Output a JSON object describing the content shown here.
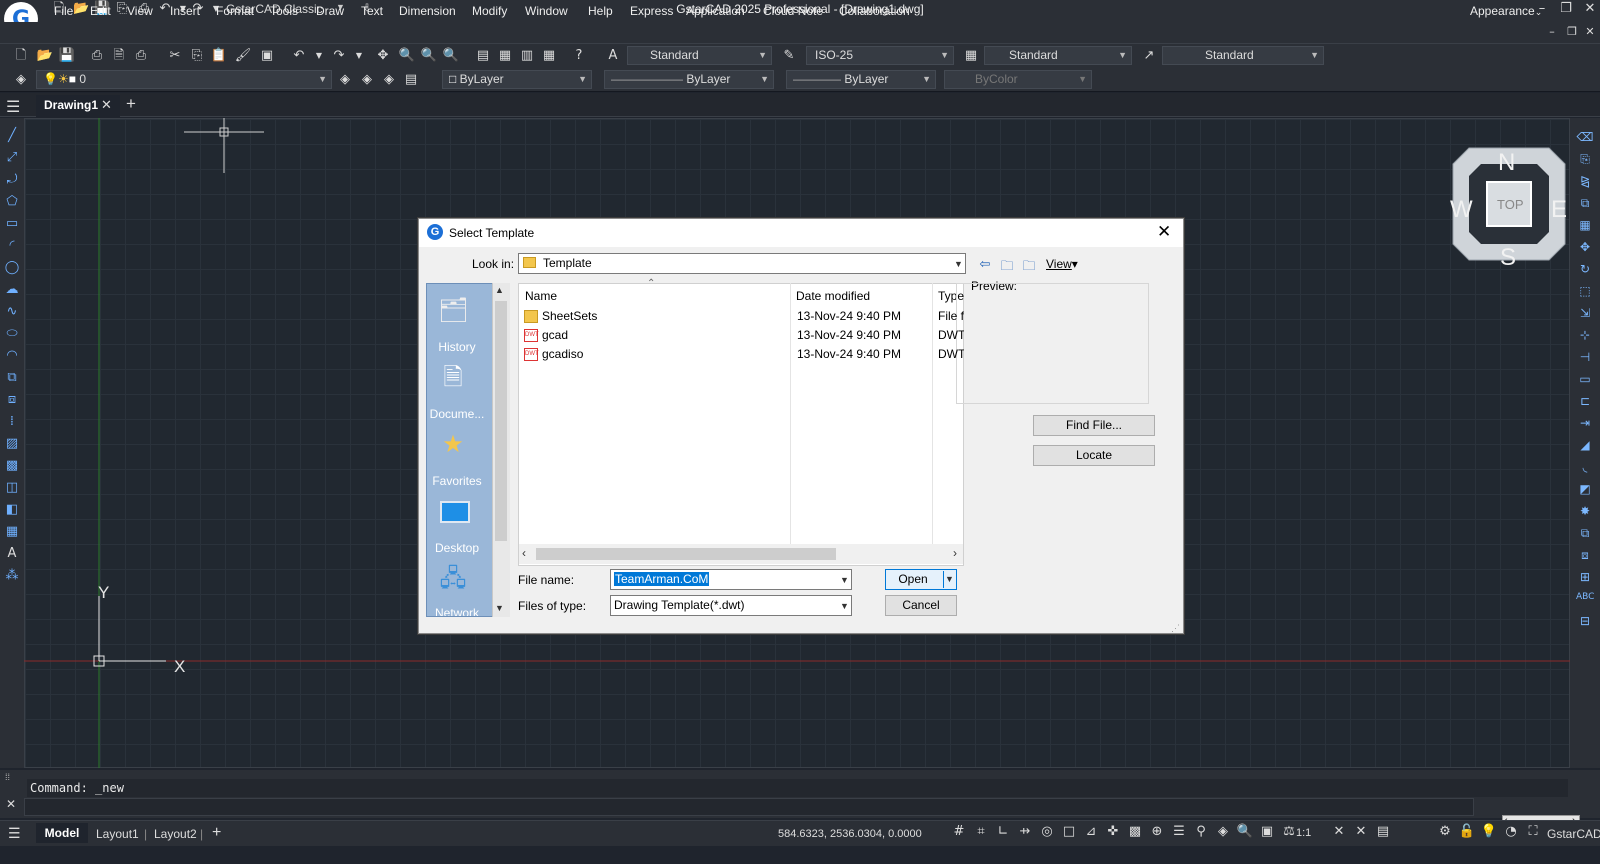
{
  "app": {
    "window_title": "GstarCAD 2025 Professional - [Drawing1.dwg]",
    "workspace": "GstarCAD Classic",
    "appearance": "Appearance"
  },
  "menu": [
    "File",
    "Edit",
    "View",
    "Insert",
    "Format",
    "Tools",
    "Draw",
    "Text",
    "Dimension",
    "Modify",
    "Window",
    "Help",
    "Express",
    "Application",
    "Cloud Note",
    "Collaboration"
  ],
  "toolbar": {
    "text_style": "Standard",
    "dim_style": "ISO-25",
    "table_style": "Standard",
    "multileader_style": "Standard",
    "layer": "0",
    "color": "ByLayer",
    "linetype": "ByLayer",
    "lineweight": "ByLayer",
    "plotstyle": "ByColor"
  },
  "tabs": {
    "document": "Drawing1"
  },
  "viewcube": {
    "n": "N",
    "s": "S",
    "e": "E",
    "w": "W",
    "top": "TOP"
  },
  "axes": {
    "y": "Y",
    "x": "X"
  },
  "command": {
    "line": "Command:  _new"
  },
  "status": {
    "model": "Model",
    "layout1": "Layout1",
    "layout2": "Layout2",
    "coords": "584.6323, 2536.0304, 0.0000",
    "scale": "1:1",
    "brand": "GstarCAD"
  },
  "dialog": {
    "title": "Select Template",
    "look_in_label": "Look in:",
    "look_in_value": "Template",
    "view_label": "View",
    "preview_label": "Preview:",
    "places": [
      "History",
      "Docume...",
      "Favorites",
      "Desktop",
      "Network"
    ],
    "columns": {
      "name": "Name",
      "date": "Date modified",
      "type": "Type"
    },
    "files": [
      {
        "name": "SheetSets",
        "date": "13-Nov-24 9:40 PM",
        "type": "File fo",
        "kind": "folder"
      },
      {
        "name": "gcad",
        "date": "13-Nov-24 9:40 PM",
        "type": "DWT",
        "kind": "dwt"
      },
      {
        "name": "gcadiso",
        "date": "13-Nov-24 9:40 PM",
        "type": "DWT",
        "kind": "dwt"
      }
    ],
    "file_name_label": "File name:",
    "file_name_value": "TeamArman.CoM",
    "file_type_label": "Files of type:",
    "file_type_value": "Drawing Template(*.dwt)",
    "open": "Open",
    "cancel": "Cancel",
    "find_file": "Find File...",
    "locate": "Locate"
  },
  "colors": {
    "accent": "#1c6fd6",
    "canvas": "#212830",
    "xaxis": "#8b2a2a",
    "yaxis": "#2a7a2a"
  }
}
